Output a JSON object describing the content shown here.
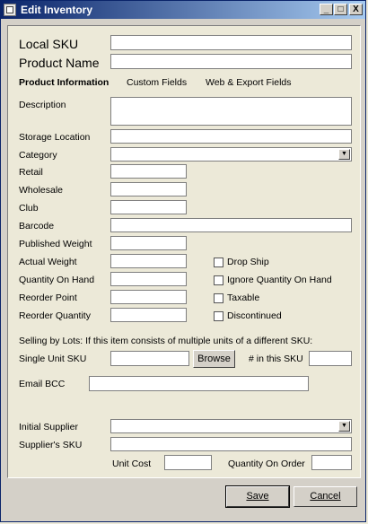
{
  "window": {
    "title": "Edit Inventory",
    "min_glyph": "_",
    "max_glyph": "□",
    "close_glyph": "X"
  },
  "fields": {
    "local_sku": {
      "label": "Local SKU",
      "value": ""
    },
    "product_name": {
      "label": "Product Name",
      "value": ""
    }
  },
  "tabs": [
    "Product Information",
    "Custom Fields",
    "Web & Export Fields"
  ],
  "labels": {
    "description": "Description",
    "storage_location": "Storage Location",
    "category": "Category",
    "retail": "Retail",
    "wholesale": "Wholesale",
    "club": "Club",
    "barcode": "Barcode",
    "published_weight": "Published Weight",
    "actual_weight": "Actual Weight",
    "quantity_on_hand": "Quantity On Hand",
    "reorder_point": "Reorder Point",
    "reorder_quantity": "Reorder Quantity",
    "lots_note": "Selling by Lots: If this item consists of multiple units of a different SKU:",
    "single_unit_sku": "Single Unit SKU",
    "in_this_sku": "# in this SKU",
    "email_bcc": "Email BCC",
    "initial_supplier": "Initial Supplier",
    "suppliers_sku": "Supplier's SKU",
    "unit_cost": "Unit Cost",
    "quantity_on_order": "Quantity On Order"
  },
  "checkboxes": [
    {
      "label": "Drop Ship",
      "checked": false
    },
    {
      "label": "Ignore Quantity On Hand",
      "checked": false
    },
    {
      "label": "Taxable",
      "checked": false
    },
    {
      "label": "Discontinued",
      "checked": false
    }
  ],
  "buttons": {
    "browse": "Browse",
    "save": "Save",
    "cancel": "Cancel"
  },
  "icons": {
    "combo_arrow": "▼"
  }
}
